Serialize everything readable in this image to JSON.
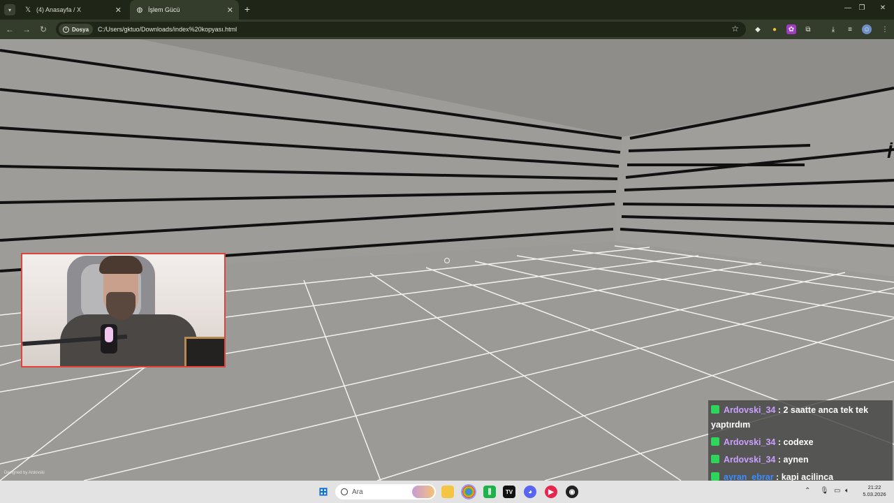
{
  "browser": {
    "tabs": [
      {
        "title": "(4) Anasayfa / X",
        "icon": "x-logo-icon",
        "active": false
      },
      {
        "title": "İşlem Gücü",
        "icon": "globe-icon",
        "active": true
      }
    ],
    "new_tab_label": "+",
    "site_info_label": "Dosya",
    "url": "C:/Users/gktuo/Downloads/index%20kopyası.html"
  },
  "page": {
    "credit": "Designed by Ardovski",
    "wall_letter": "İ"
  },
  "chat": {
    "messages": [
      {
        "user": "Ardovski_34",
        "sep": " : ",
        "text": "2 saatte anca tek tek yaptırdım"
      },
      {
        "user": "Ardovski_34",
        "sep": " : ",
        "text": "codexe"
      },
      {
        "user": "Ardovski_34",
        "sep": " : ",
        "text": "aynen"
      },
      {
        "user": "ayran_ebrar",
        "sep": " : ",
        "text": "kapi acilinca duygulandim"
      }
    ]
  },
  "taskbar": {
    "search_label": "Ara",
    "time": "21:22",
    "date": "5.03.2026"
  },
  "colors": {
    "tab_bar": "#1f2618",
    "toolbar": "#343c2c",
    "scene_gray": "#9a9894",
    "webcam_border": "#e0433a",
    "chat_user": "#c9a0ff",
    "chat_user_alt": "#3a8eff",
    "chat_badge": "#2fd45a"
  }
}
